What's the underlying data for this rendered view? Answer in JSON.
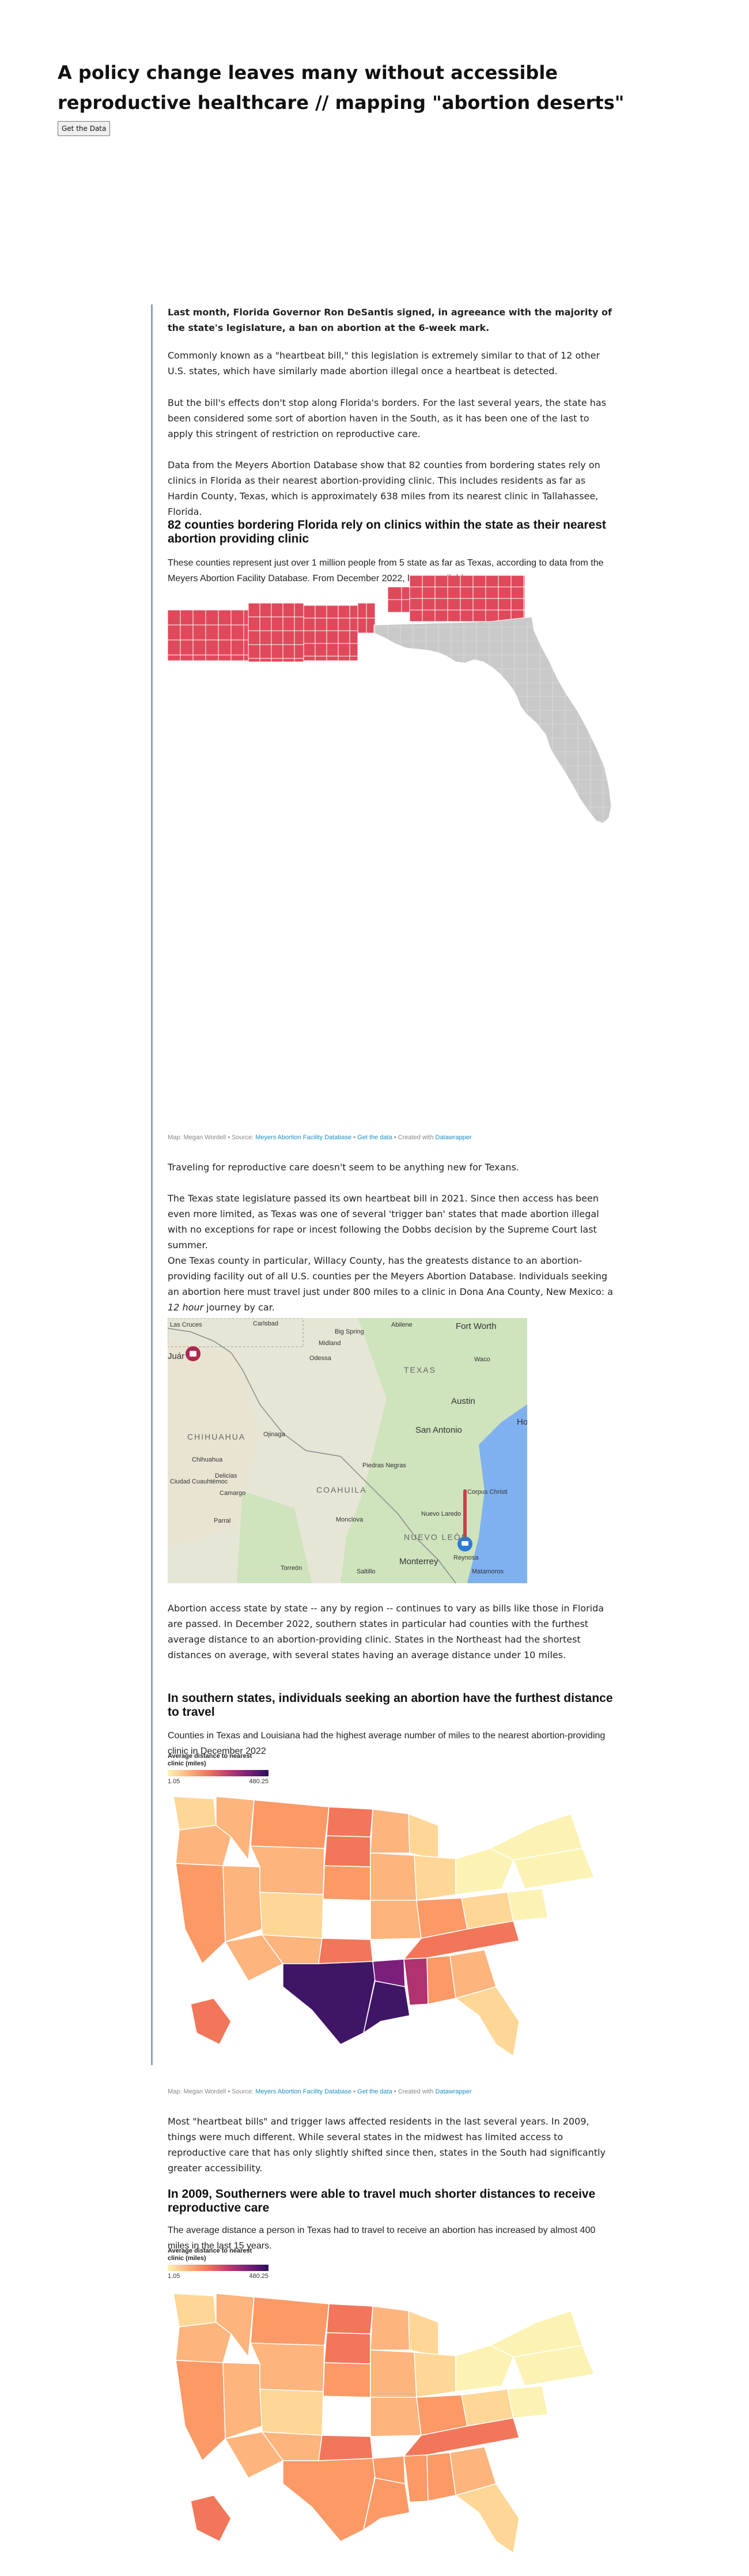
{
  "page": {
    "title": "A policy change leaves many without accessible reproductive healthcare // mapping \"abortion deserts\"",
    "get_data_button": "Get the Data"
  },
  "article": {
    "p1": "Last month, Florida Governor Ron DeSantis signed, in agreeance with the majority of the state's legislature, a ban on abortion at the 6-week mark.",
    "p2": "Commonly known as a \"heartbeat bill,\" this legislation is extremely similar to that of 12 other U.S. states, which have similarly made abortion illegal once a heartbeat is detected.",
    "p3": "But the bill's effects don't stop along Florida's borders. For the last several years, the state has been considered some sort of abortion haven in the South, as it has been one of the last to apply this stringent of restriction on reproductive care.",
    "p4": "Data from the Meyers Abortion Database show that 82 counties from bordering states rely on clinics in Florida as their nearest abortion-providing clinic. This includes residents as far as Hardin County, Texas, which is approximately 638 miles from its nearest clinic in Tallahassee, Florida.",
    "p5": "Traveling for reproductive care doesn't seem to be anything new for Texans.",
    "p6": "The Texas state legislature passed its own heartbeat bill in 2021. Since then access has been even more limited, as Texas was one of several 'trigger ban' states that made abortion illegal with no exceptions for rape or incest following the Dobbs decision by the Supreme Court last summer.",
    "p7_a": "One Texas county in particular, Willacy County, has the greatests distance to an abortion-providing facility out of all U.S. counties per the Meyers Abortion Database. Individuals seeking an abortion here must travel just under 800 miles to a clinic in Dona Ana County, New Mexico: a ",
    "p7_em": "12 hour",
    "p7_b": " journey by car.",
    "p8": "Abortion access state by state -- any by region -- continues to vary as bills like those in Florida are passed. In December 2022, southern states in particular had counties with the furthest average distance to an abortion-providing clinic. States in the Northeast had the shortest distances on average, with several states having an average distance under 10 miles.",
    "p9": "Most \"heartbeat bills\" and trigger laws affected residents in the last several years. In 2009, things were much different. While several states in the midwest has limited access to reproductive care that has only slightly shifted since then, states in the South had significantly greater accessibility."
  },
  "credit": {
    "author": "Map: Megan Wordell",
    "source_label": "Source:",
    "source_link": "Meyers Abortion Facility Database",
    "get_data": "Get the data",
    "created_with": "Created with",
    "tool": "Datawrapper",
    "sep": "•"
  },
  "chart1": {
    "title": "82 counties bordering Florida rely on clinics within the state as their nearest abortion providing clinic",
    "subtitle": "These counties represent just over 1 million people from 5 state as far as Texas, according to data from the Meyers Abortion Facility Database. From December 2022, latest available.",
    "colors": {
      "relying": "#e0495b",
      "florida": "#c9c9c9",
      "stroke": "#ffffff"
    }
  },
  "routemap": {
    "labels": {
      "las_cruces": "Las Cruces",
      "carlsbad": "Carlsbad",
      "big_spring": "Big Spring",
      "abilene": "Abilene",
      "fort_worth": "Fort Worth",
      "juarez": "Juár",
      "midland": "Midland",
      "odessa": "Odessa",
      "texas": "TEXAS",
      "waco": "Waco",
      "austin": "Austin",
      "san_antonio": "San Antonio",
      "houston": "Ho",
      "chihuahua_state": "CHIHUAHUA",
      "ojinaga": "Ojinaga",
      "chihuahua": "Chihuahua",
      "piedras_negras": "Piedras Negras",
      "delicias": "Delicias",
      "ciudad_cuauhtemoc": "Ciudad Cuauhtémoc",
      "camargo": "Camargo",
      "coahuila": "COAHUILA",
      "corpus_christi": "Corpus Christi",
      "monclova": "Monclova",
      "nuevo_laredo": "Nuevo Laredo",
      "parral": "Parral",
      "nuevo_leon": "NUEVO LEÓN",
      "reynosa": "Reynosa",
      "torreon": "Torreón",
      "saltillo": "Saltillo",
      "monterrey": "Monterrey",
      "matamoros": "Matamoros"
    },
    "colors": {
      "land": "#e3e7d4",
      "green": "#b8d9a8",
      "water": "#7fb0f0",
      "route": "#d23c48",
      "marker_origin": "#2c7bd8",
      "marker_dest": "#b0284f"
    }
  },
  "chart2": {
    "title": "In southern states, individuals seeking an abortion have the furthest distance to travel",
    "subtitle": "Counties in Texas and Louisiana had the highest average number of miles to the nearest abortion-providing clinic in December 2022",
    "legend_title": "Average distance to nearest clinic (miles)",
    "legend_min": "1.05",
    "legend_max": "480.25"
  },
  "chart3": {
    "title": "In 2009, Southerners were able to travel much shorter distances to receive reproductive care",
    "subtitle": "The average distance a person in Texas had to travel to receive an abortion has increased by almost 400 miles in the last 15 years.",
    "legend_title": "Average distance to nearest clinic (miles)",
    "legend_min": "1.05",
    "legend_max": "480.25"
  }
}
